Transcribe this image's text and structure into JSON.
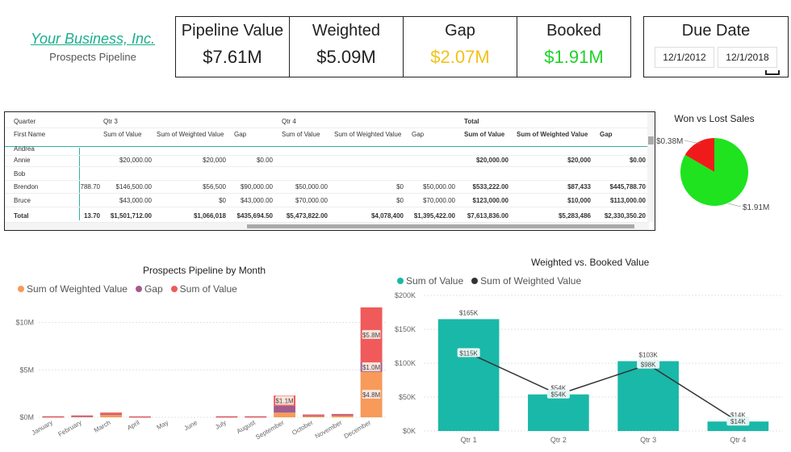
{
  "brand": {
    "name": "Your Business, Inc.",
    "subtitle": "Prospects Pipeline"
  },
  "kpis": [
    {
      "label": "Pipeline Value",
      "value": "$7.61M",
      "color": "#222222"
    },
    {
      "label": "Weighted",
      "value": "$5.09M",
      "color": "#222222"
    },
    {
      "label": "Gap",
      "value": "$2.07M",
      "color": "#f2c218"
    },
    {
      "label": "Booked",
      "value": "$1.91M",
      "color": "#1fd32a"
    }
  ],
  "due_date": {
    "title": "Due Date",
    "start": "12/1/2012",
    "end": "12/1/2018"
  },
  "matrix": {
    "header": {
      "quarter": "Quarter",
      "q3": "Qtr 3",
      "q4": "Qtr 4",
      "total": "Total"
    },
    "subheader": {
      "first_name": "First Name",
      "sum_value": "Sum of Value",
      "sum_weighted": "Sum of Weighted Value",
      "gap": "Gap"
    },
    "rows": [
      {
        "name": "Andrea",
        "c0": "",
        "q3v": "",
        "q3w": "",
        "q3g": "",
        "q4v": "",
        "q4w": "",
        "q4g": "",
        "tv": "",
        "tw": "",
        "tg": ""
      },
      {
        "name": "Annie",
        "c0": "",
        "q3v": "$20,000.00",
        "q3w": "$20,000",
        "q3g": "$0.00",
        "q4v": "",
        "q4w": "",
        "q4g": "",
        "tv": "$20,000.00",
        "tw": "$20,000",
        "tg": "$0.00"
      },
      {
        "name": "Bob",
        "c0": "",
        "q3v": "",
        "q3w": "",
        "q3g": "",
        "q4v": "",
        "q4w": "",
        "q4g": "",
        "tv": "",
        "tw": "",
        "tg": ""
      },
      {
        "name": "Brendon",
        "c0": "788.70",
        "q3v": "$146,500.00",
        "q3w": "$56,500",
        "q3g": "$90,000.00",
        "q4v": "$50,000.00",
        "q4w": "$0",
        "q4g": "$50,000.00",
        "tv": "$533,222.00",
        "tw": "$87,433",
        "tg": "$445,788.70"
      },
      {
        "name": "Bruce",
        "c0": "",
        "q3v": "$43,000.00",
        "q3w": "$0",
        "q3g": "$43,000.00",
        "q4v": "$70,000.00",
        "q4w": "$0",
        "q4g": "$70,000.00",
        "tv": "$123,000.00",
        "tw": "$10,000",
        "tg": "$113,000.00"
      }
    ],
    "total": {
      "name": "Total",
      "c0": "13.70",
      "q3v": "$1,501,712.00",
      "q3w": "$1,066,018",
      "q3g": "$435,694.50",
      "q4v": "$5,473,822.00",
      "q4w": "$4,078,400",
      "q4g": "$1,395,422.00",
      "tv": "$7,613,836.00",
      "tw": "$5,283,486",
      "tg": "$2,330,350.20"
    }
  },
  "pie": {
    "title": "Won vs Lost Sales",
    "labels": {
      "lost": "$0.38M",
      "won": "$1.91M"
    }
  },
  "monthly_chart": {
    "title": "Prospects Pipeline by Month",
    "legend": [
      "Sum of Weighted Value",
      "Gap",
      "Sum of Value"
    ]
  },
  "weighted_chart": {
    "title": "Weighted vs. Booked Value",
    "legend": [
      "Sum of Value",
      "Sum of Weighted Value"
    ]
  },
  "colors": {
    "weighted": "#f79a5a",
    "gap": "#a05c8f",
    "value": "#f05a5a",
    "teal": "#1ab8a8",
    "line": "#333333",
    "won": "#1ee31e",
    "lost": "#ef1b1b"
  },
  "chart_data": [
    {
      "type": "pie",
      "title": "Won vs Lost Sales",
      "slices": [
        {
          "label": "$0.38M",
          "value": 0.38,
          "color": "#ef1b1b"
        },
        {
          "label": "$1.91M",
          "value": 1.91,
          "color": "#1ee31e"
        }
      ]
    },
    {
      "type": "bar",
      "title": "Prospects Pipeline by Month",
      "stacked": true,
      "categories": [
        "January",
        "February",
        "March",
        "April",
        "May",
        "June",
        "July",
        "August",
        "September",
        "October",
        "November",
        "December"
      ],
      "ylim": [
        0,
        11.5
      ],
      "yticks": [
        "$0M",
        "$5M",
        "$10M"
      ],
      "series": [
        {
          "name": "Sum of Weighted Value",
          "values": [
            0.05,
            0.1,
            0.3,
            0.05,
            0,
            0,
            0.05,
            0.05,
            0.5,
            0.15,
            0.2,
            4.8
          ]
        },
        {
          "name": "Gap",
          "values": [
            0.02,
            0.02,
            0.05,
            0.01,
            0,
            0,
            0.02,
            0.02,
            0.7,
            0.05,
            0.05,
            1.0
          ]
        },
        {
          "name": "Sum of Value",
          "values": [
            0.04,
            0.08,
            0.15,
            0.04,
            0,
            0,
            0.04,
            0.04,
            1.1,
            0.1,
            0.1,
            5.8
          ]
        }
      ],
      "data_labels": {
        "September": {
          "Sum of Value": "$1.1M"
        },
        "December": {
          "Sum of Weighted Value": "$4.8M",
          "Gap": "$1.0M",
          "Sum of Value": "$5.8M"
        }
      }
    },
    {
      "type": "bar",
      "title": "Weighted vs. Booked Value",
      "categories": [
        "Qtr 1",
        "Qtr 2",
        "Qtr 3",
        "Qtr 4"
      ],
      "ylim": [
        0,
        200
      ],
      "yticks": [
        "$0K",
        "$50K",
        "$100K",
        "$150K",
        "$200K"
      ],
      "series": [
        {
          "name": "Sum of Value",
          "kind": "bar",
          "values": [
            165,
            54,
            103,
            14
          ],
          "labels": [
            "$165K",
            "$54K",
            "$103K",
            "$14K"
          ]
        },
        {
          "name": "Sum of Weighted Value",
          "kind": "line",
          "values": [
            115,
            54,
            98,
            14
          ],
          "labels": [
            "$115K",
            "$54K",
            "$98K",
            "$14K"
          ]
        }
      ]
    }
  ]
}
